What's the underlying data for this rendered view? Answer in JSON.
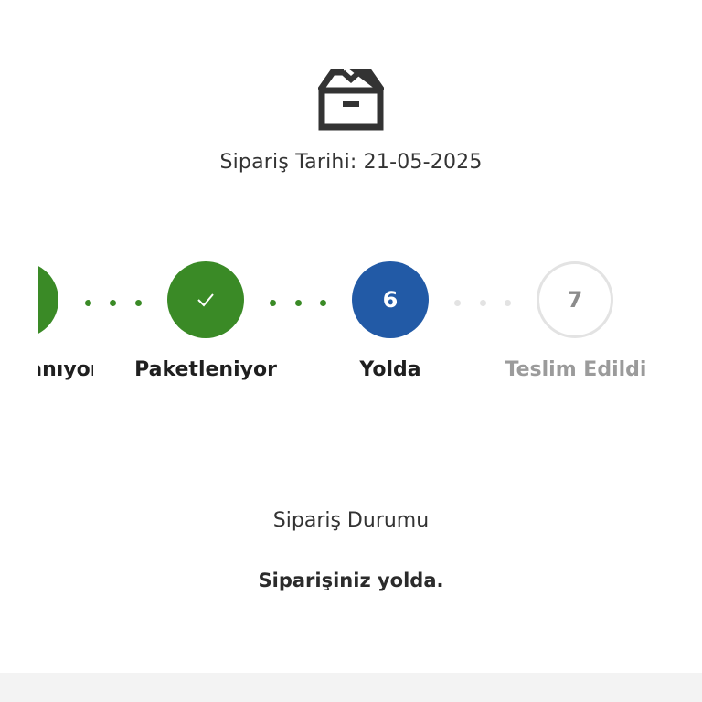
{
  "header": {
    "icon": "package-box-icon",
    "order_date": "Sipariş Tarihi: 21-05-2025"
  },
  "stepper": {
    "steps": [
      {
        "label": "Hazırlanıyor",
        "state": "done",
        "number": "",
        "icon": "check-icon"
      },
      {
        "label": "Paketleniyor",
        "state": "done",
        "number": "",
        "icon": "check-icon"
      },
      {
        "label": "Yolda",
        "state": "current",
        "number": "6"
      },
      {
        "label": "Teslim Edildi",
        "state": "pending",
        "number": "7"
      }
    ],
    "colors": {
      "done": "#3a8a26",
      "current": "#225aa6",
      "pending_border": "#e3e3e3"
    }
  },
  "status": {
    "title": "Sipariş Durumu",
    "message": "Siparişiniz yolda."
  }
}
